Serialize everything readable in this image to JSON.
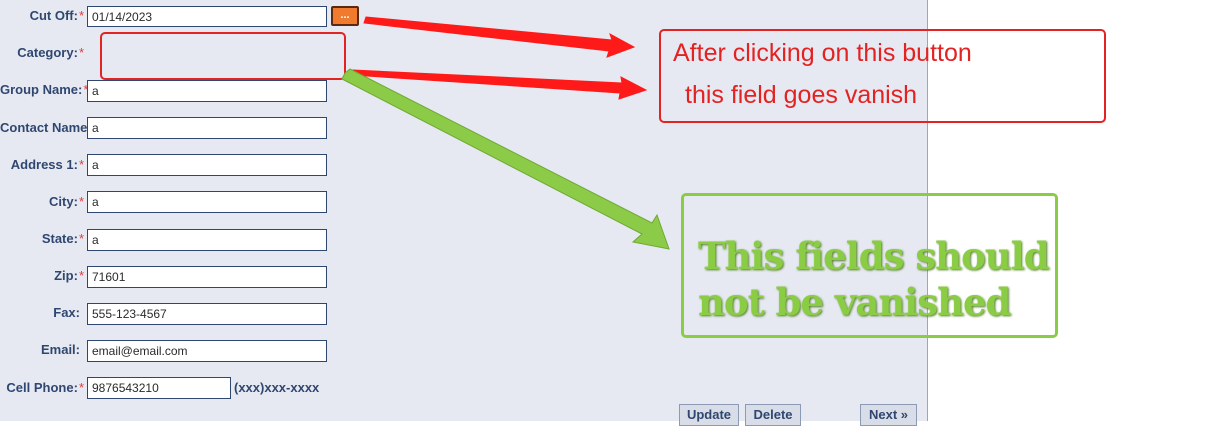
{
  "form": {
    "fields": [
      {
        "id": "cut-off",
        "label": "Cut Off:",
        "required": true,
        "value": "01/14/2023"
      },
      {
        "id": "category",
        "label": "Category:",
        "required": true,
        "value": ""
      },
      {
        "id": "group-name",
        "label": "Group Name:",
        "required": true,
        "value": "a"
      },
      {
        "id": "contact-name",
        "label": "Contact Name:",
        "required": true,
        "value": "a"
      },
      {
        "id": "address-1",
        "label": "Address 1:",
        "required": true,
        "value": "a"
      },
      {
        "id": "city",
        "label": "City:",
        "required": true,
        "value": "a"
      },
      {
        "id": "state",
        "label": "State:",
        "required": true,
        "value": "a"
      },
      {
        "id": "zip",
        "label": "Zip:",
        "required": true,
        "value": "71601"
      },
      {
        "id": "fax",
        "label": "Fax:",
        "required": false,
        "value": "555-123-4567"
      },
      {
        "id": "email",
        "label": "Email:",
        "required": false,
        "value": "email@email.com"
      },
      {
        "id": "cell-phone",
        "label": "Cell Phone:",
        "required": true,
        "value": "9876543210"
      }
    ],
    "required_marker": "*",
    "calendar_button_label": "...",
    "phone_format_hint": "(xxx)xxx-xxxx",
    "buttons": {
      "update": "Update",
      "delete": "Delete",
      "next": "Next »"
    }
  },
  "annotations": {
    "red_callout": {
      "line1": "After clicking on this button",
      "line2": "this field goes vanish"
    },
    "green_callout": {
      "line1": "This fields should",
      "line2": "not be vanished"
    },
    "colors": {
      "red": "#e32222",
      "green": "#8acd45"
    }
  }
}
